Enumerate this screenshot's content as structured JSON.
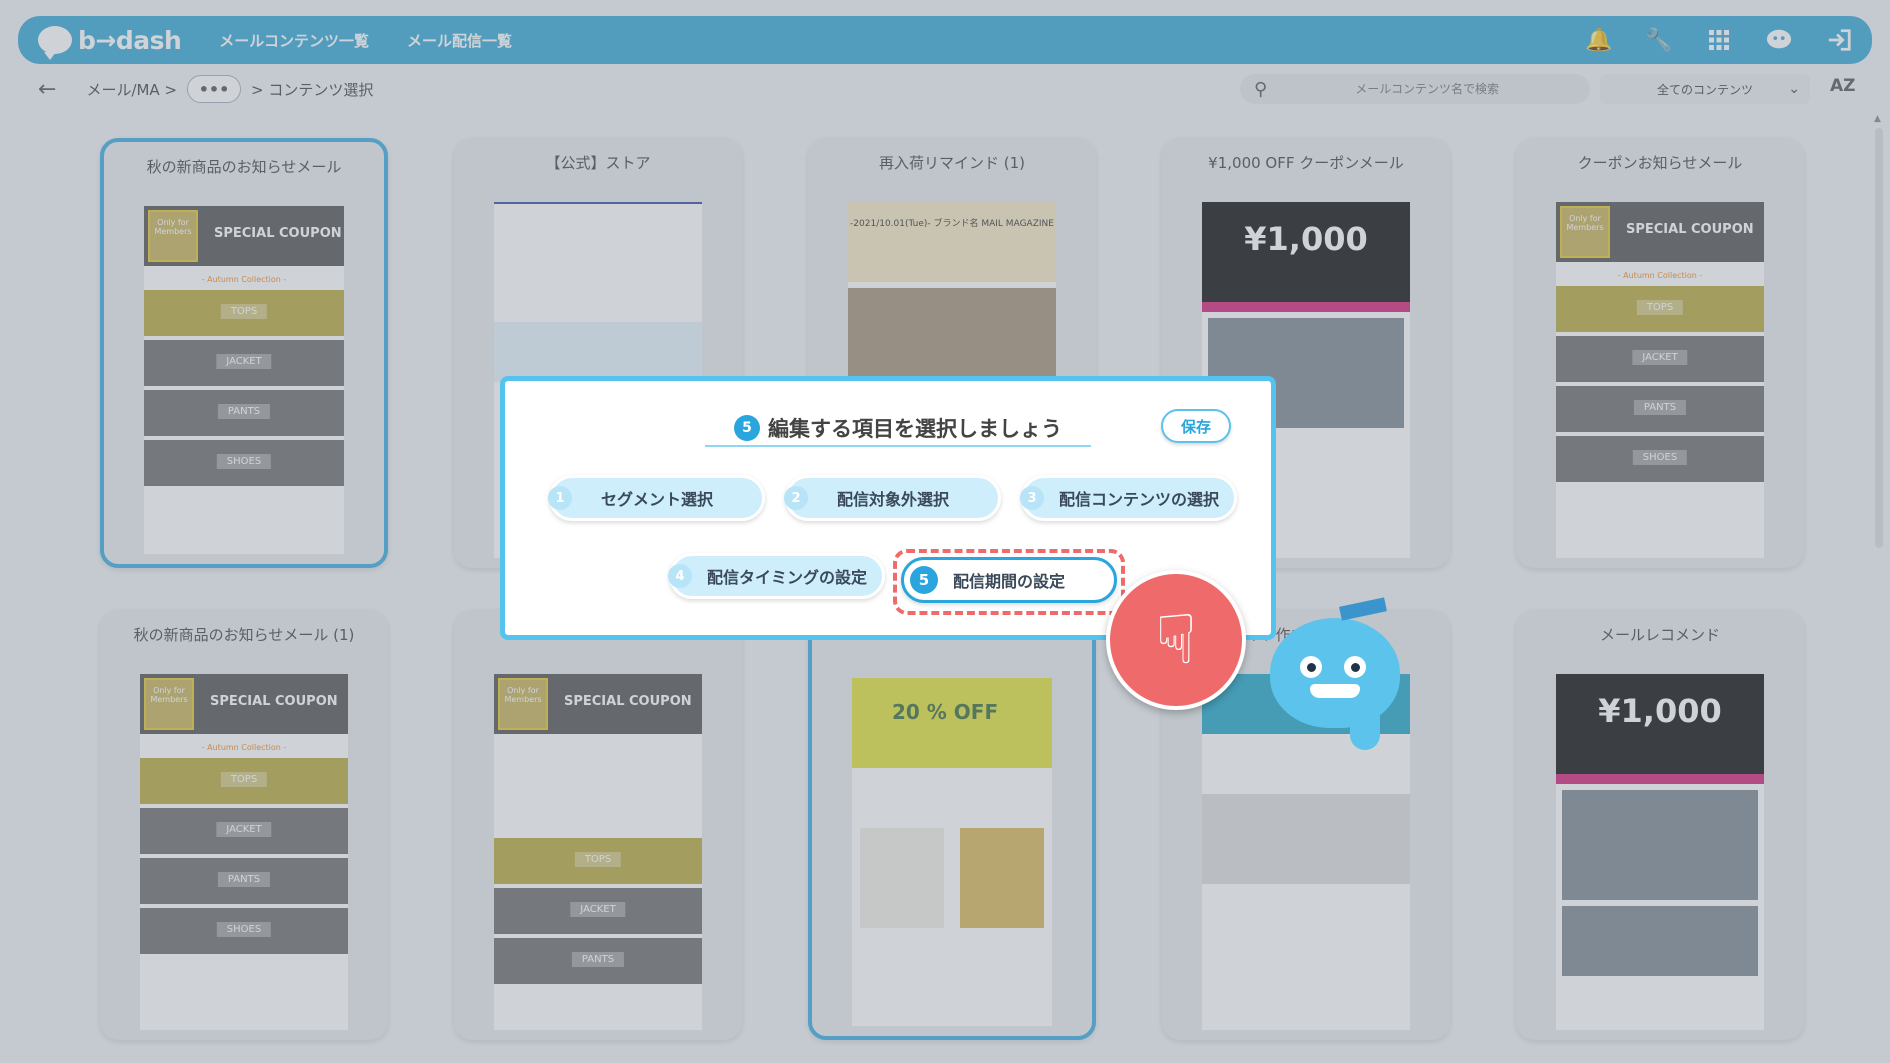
{
  "app": {
    "logo_text": "b→dash",
    "nav": [
      "メールコンテンツ一覧",
      "メール配信一覧"
    ]
  },
  "header_icons": [
    "bell-icon",
    "wrench-icon",
    "apps-grid-icon",
    "support-chat-icon",
    "logout-icon"
  ],
  "breadcrumb": {
    "first": "メール/MA >",
    "ellipsis": "•••",
    "last": "> コンテンツ選択"
  },
  "search": {
    "placeholder": "メールコンテンツ名で検索"
  },
  "filter": {
    "selected": "全てのコンテンツ"
  },
  "sort_label": "AZ",
  "cards": [
    {
      "title": "秋の新商品のお知らせメール"
    },
    {
      "title": "【公式】ストア"
    },
    {
      "title": "再入荷リマインド (1)"
    },
    {
      "title": "¥1,000 OFF クーポンメール"
    },
    {
      "title": "クーポンお知らせメール"
    },
    {
      "title": "秋の新商品のお知らせメール (1)"
    },
    {
      "title": ""
    },
    {
      "title": ""
    },
    {
      "title": "イト作成用_1072"
    },
    {
      "title": "メールレコメンド"
    }
  ],
  "thumb_text": {
    "special_coupon": "SPECIAL COUPON",
    "only_members": "Only for Members",
    "autumn": "- Autumn Collection -",
    "tops": "TOPS",
    "jacket": "JACKET",
    "pants": "PANTS",
    "shoes": "SHOES",
    "coupon_price": "¥1,000",
    "magazine": "-2021/10.01(Tue)- ブランド名 MAIL MAGAZINE",
    "coupon_20": "20 % OFF"
  },
  "modal": {
    "title_num": "5",
    "title": "編集する項目を選択しましょう",
    "save": "保存",
    "steps": [
      {
        "num": "1",
        "label": "セグメント選択"
      },
      {
        "num": "2",
        "label": "配信対象外選択"
      },
      {
        "num": "3",
        "label": "配信コンテンツの選択"
      },
      {
        "num": "4",
        "label": "配信タイミングの設定"
      },
      {
        "num": "5",
        "label": "配信期間の設定"
      }
    ]
  },
  "colors": {
    "brand": "#36a9d6",
    "accent": "#2aa5dd",
    "highlight": "#ef6a6a"
  }
}
